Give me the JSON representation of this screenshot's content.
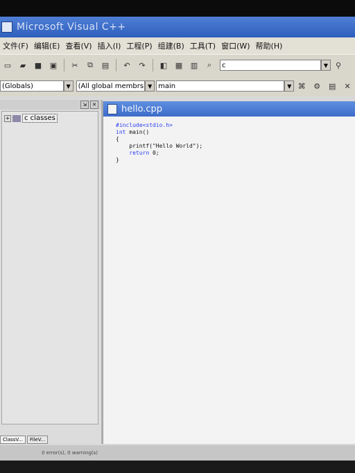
{
  "window": {
    "title": "Microsoft Visual C++"
  },
  "menu": [
    "文件(F)",
    "编辑(E)",
    "查看(V)",
    "插入(I)",
    "工程(P)",
    "组建(B)",
    "工具(T)",
    "窗口(W)",
    "帮助(H)"
  ],
  "toolbar": {
    "buttons": [
      "new-icon",
      "open-icon",
      "save-icon",
      "save-all-icon",
      "cut-icon",
      "copy-icon",
      "paste-icon",
      "undo-icon",
      "redo-icon",
      "workspace-icon",
      "output-icon",
      "window-list-icon",
      "find-in-files-icon"
    ],
    "find_value": "c"
  },
  "wizard": {
    "scope": "(Globals)",
    "members": "(All global membrs",
    "function": "main"
  },
  "workspace": {
    "tree_root": "c classes",
    "tabs": [
      "ClassV...",
      "FileV..."
    ]
  },
  "editor": {
    "filename": "hello.cpp",
    "code": [
      {
        "a": "#include<stdio.h>",
        "b": ""
      },
      {
        "a": "int",
        "b": " main()"
      },
      {
        "a": "",
        "b": "{"
      },
      {
        "a": "",
        "b": "    printf(\"Hello World\");"
      },
      {
        "a": "    return",
        "b": " 0;"
      },
      {
        "a": "",
        "b": "}"
      }
    ]
  },
  "output": {
    "text": "0 error(s), 0 warning(s)"
  }
}
